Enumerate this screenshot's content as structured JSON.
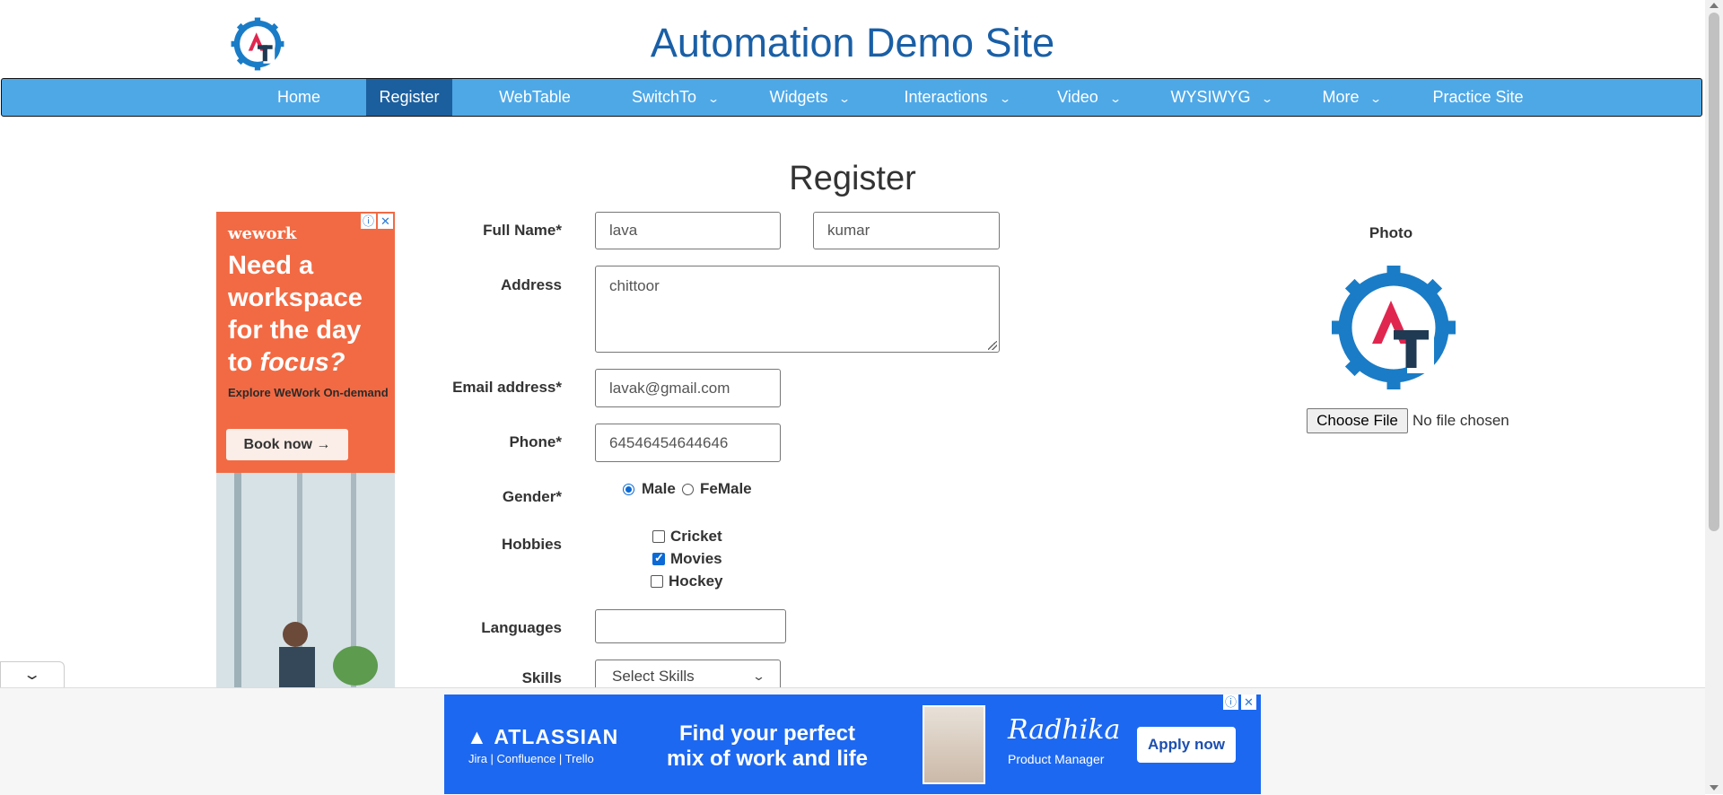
{
  "site": {
    "title": "Automation Demo Site"
  },
  "nav": {
    "items": [
      {
        "label": "Home"
      },
      {
        "label": "Register"
      },
      {
        "label": "WebTable"
      },
      {
        "label": "SwitchTo"
      },
      {
        "label": "Widgets"
      },
      {
        "label": "Interactions"
      },
      {
        "label": "Video"
      },
      {
        "label": "WYSIWYG"
      },
      {
        "label": "More"
      },
      {
        "label": "Practice Site"
      }
    ],
    "active": "Register",
    "chevron": "⌄"
  },
  "form": {
    "heading": "Register",
    "full_name_label": "Full Name*",
    "first_name_value": "lava",
    "last_name_value": "kumar",
    "address_label": "Address",
    "address_value": "chittoor",
    "email_label": "Email address*",
    "email_value": "lavak@gmail.com",
    "phone_label": "Phone*",
    "phone_value": "64546454644646",
    "gender_label": "Gender*",
    "gender_options": [
      "Male",
      "FeMale"
    ],
    "gender_selected": "Male",
    "hobbies_label": "Hobbies",
    "hobbies": [
      {
        "label": "Cricket",
        "checked": false
      },
      {
        "label": "Movies",
        "checked": true
      },
      {
        "label": "Hockey",
        "checked": false
      }
    ],
    "languages_label": "Languages",
    "languages_value": "",
    "skills_label": "Skills",
    "skills_value": "Select Skills"
  },
  "photo": {
    "label": "Photo",
    "choose_button": "Choose File",
    "file_status": "No file chosen"
  },
  "ad_left": {
    "brand": "wework",
    "headline_1": "Need a workspace for the day to ",
    "headline_2": "focus?",
    "sub": "Explore WeWork On-demand",
    "cta": "Book now →"
  },
  "ad_bottom": {
    "brand": "ATLASSIAN",
    "products": "Jira | Confluence | Trello",
    "headline": "Find your perfect mix of work and life",
    "name": "Radhika",
    "role": "Product Manager",
    "cta": "Apply now"
  },
  "colors": {
    "title": "#1a5fa6",
    "nav_bg": "#4fa8e6",
    "nav_active": "#1c5f9e",
    "ad_left_bg": "#f26a43",
    "ad_bottom_bg": "#1d68f0",
    "logo_blue": "#1a7cc6",
    "logo_red": "#e0264f",
    "logo_dark": "#1f3a52"
  }
}
